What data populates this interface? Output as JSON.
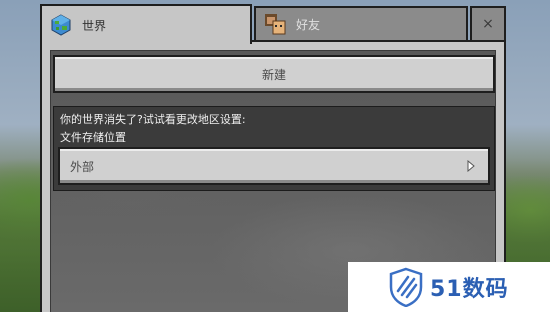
{
  "tabs": [
    {
      "label": "世界",
      "icon": "globe-icon"
    },
    {
      "label": "好友",
      "icon": "friends-icon"
    }
  ],
  "close_label": "×",
  "main": {
    "new_button_label": "新建",
    "notice": "你的世界消失了?试试看更改地区设置:",
    "storage_label": "文件存储位置",
    "storage_value": "外部",
    "storage_chevron_icon": "chevron-right-icon"
  },
  "watermark": {
    "text": "51数码"
  },
  "colors": {
    "panel_bg": "#c6c6c6",
    "dark_panel": "#3b3b3b",
    "watermark_blue": "#2b5fb3"
  }
}
